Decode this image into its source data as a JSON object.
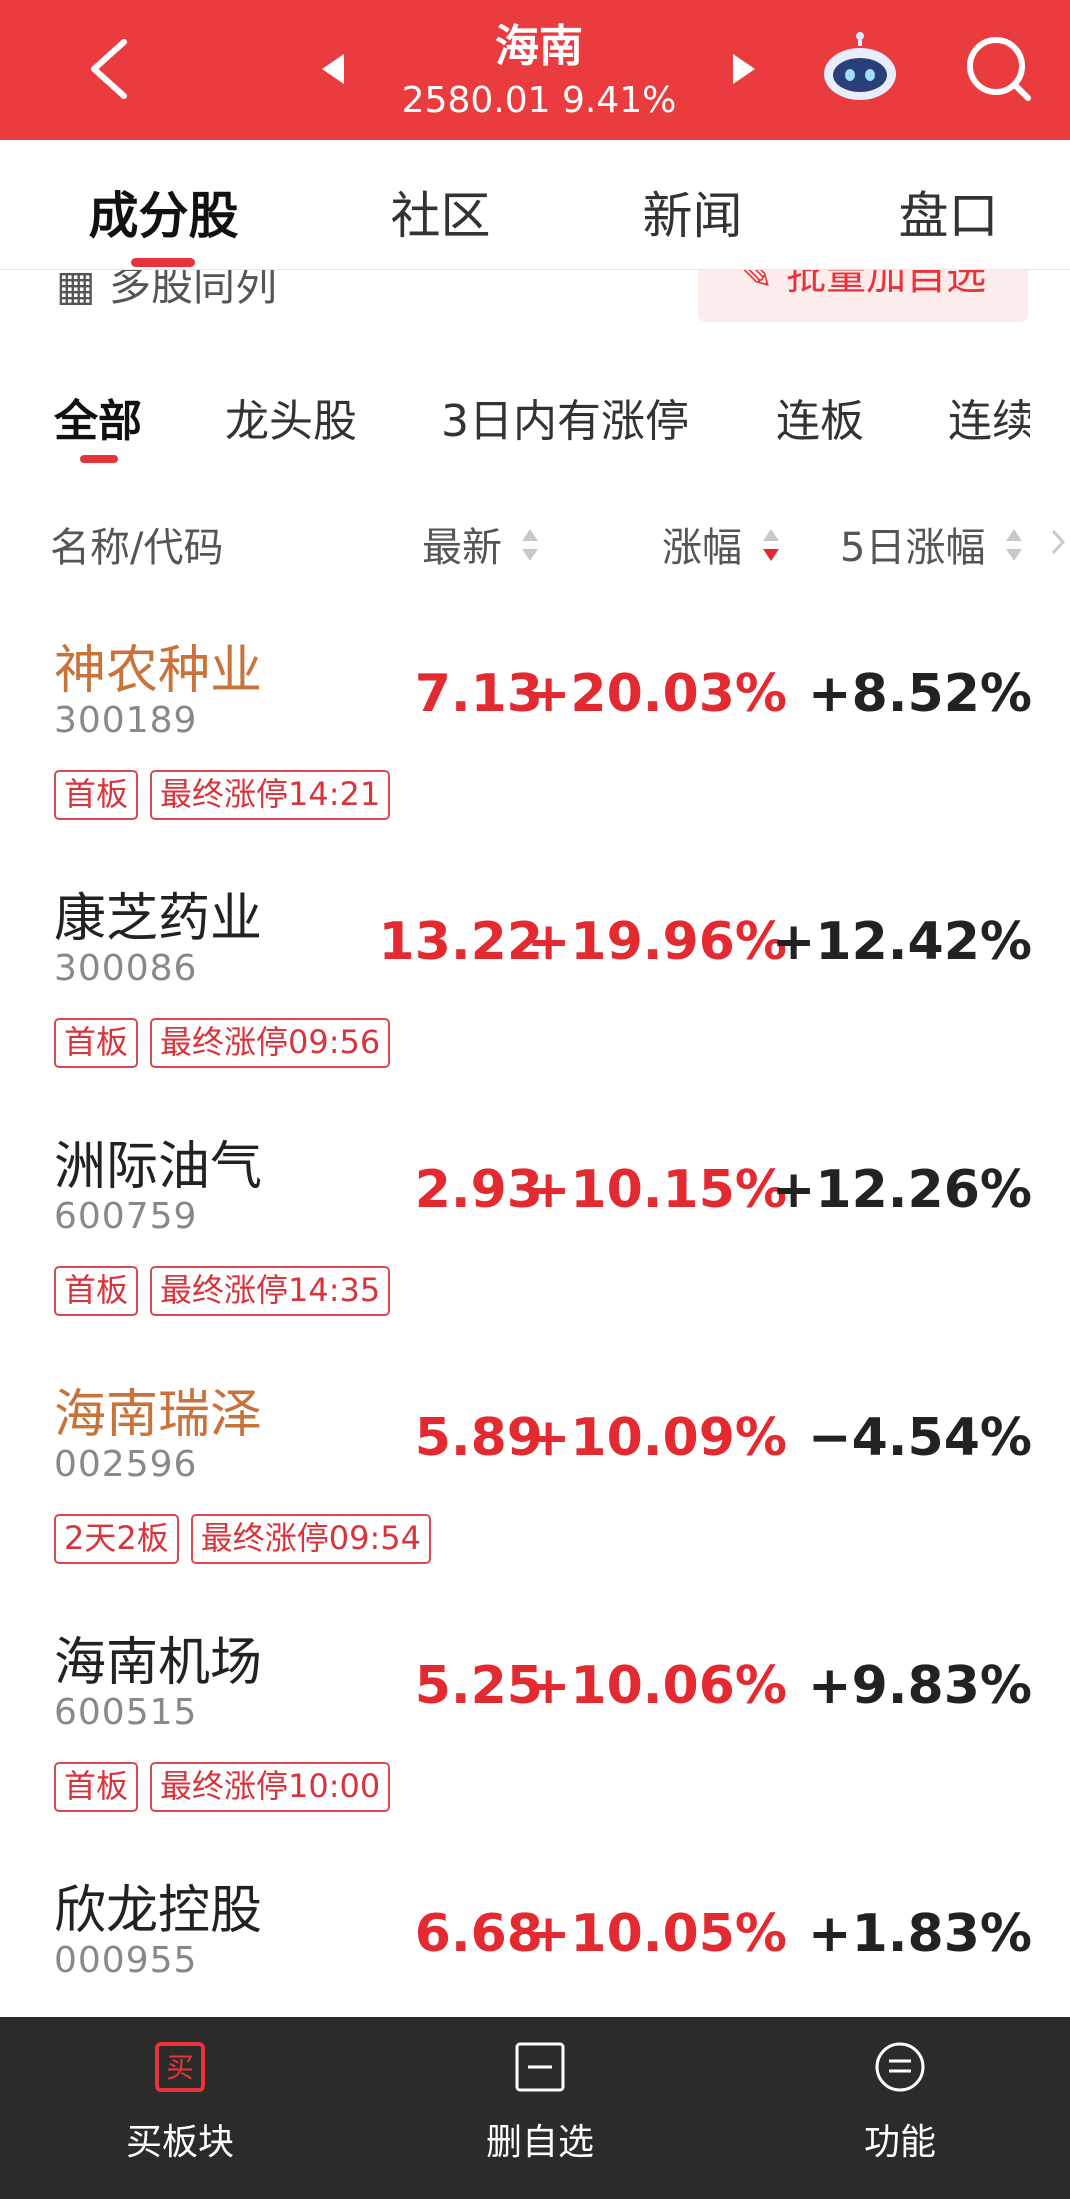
{
  "header": {
    "title": "海南",
    "index_value": "2580.01",
    "index_change": "9.41%"
  },
  "main_tabs": [
    {
      "label": "成分股",
      "active": true
    },
    {
      "label": "社区",
      "active": false
    },
    {
      "label": "新闻",
      "active": false
    },
    {
      "label": "盘口",
      "active": false
    }
  ],
  "toolbar": {
    "multi_column_label": "多股同列",
    "batch_add_label": "批量加自选"
  },
  "sub_tabs": [
    {
      "label": "全部",
      "active": true
    },
    {
      "label": "龙头股",
      "active": false
    },
    {
      "label": "3日内有涨停",
      "active": false
    },
    {
      "label": "连板",
      "active": false
    },
    {
      "label": "连续",
      "active": false
    }
  ],
  "columns": {
    "name": "名称/代码",
    "latest": "最新",
    "change": "涨幅",
    "change5d": "5日涨幅"
  },
  "stocks": [
    {
      "name": "神农种业",
      "code": "300189",
      "price": "7.13",
      "change": "+20.03%",
      "change5d": "+8.52%",
      "highlight": true,
      "tags": [
        "首板",
        "最终涨停14:21"
      ]
    },
    {
      "name": "康芝药业",
      "code": "300086",
      "price": "13.22",
      "change": "+19.96%",
      "change5d": "+12.42%",
      "highlight": false,
      "tags": [
        "首板",
        "最终涨停09:56"
      ]
    },
    {
      "name": "洲际油气",
      "code": "600759",
      "price": "2.93",
      "change": "+10.15%",
      "change5d": "+12.26%",
      "highlight": false,
      "tags": [
        "首板",
        "最终涨停14:35"
      ]
    },
    {
      "name": "海南瑞泽",
      "code": "002596",
      "price": "5.89",
      "change": "+10.09%",
      "change5d": "−4.54%",
      "highlight": true,
      "tags": [
        "2天2板",
        "最终涨停09:54"
      ]
    },
    {
      "name": "海南机场",
      "code": "600515",
      "price": "5.25",
      "change": "+10.06%",
      "change5d": "+9.83%",
      "highlight": false,
      "tags": [
        "首板",
        "最终涨停10:00"
      ]
    },
    {
      "name": "欣龙控股",
      "code": "000955",
      "price": "6.68",
      "change": "+10.05%",
      "change5d": "+1.83%",
      "highlight": false,
      "tags": []
    }
  ],
  "bottom_bar": {
    "buy_sector": "买板块",
    "remove_watchlist": "删自选",
    "functions": "功能",
    "buy_icon_glyph": "买"
  },
  "colors": {
    "brand_red": "#ea3b3f",
    "up_red": "#e22a30",
    "highlight_orange": "#c9733b",
    "bottom_bar": "#2b2b2b"
  }
}
